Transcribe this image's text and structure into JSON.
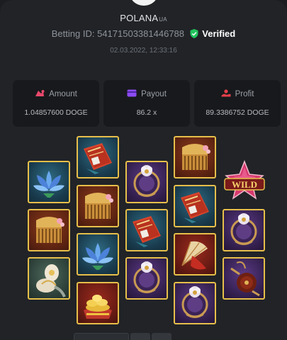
{
  "header": {
    "username": "POLANA",
    "username_suffix": "UA",
    "bet_id_label": "Betting ID:",
    "bet_id": "54171503381446788",
    "verified_label": "Verified",
    "timestamp": "02.03.2022, 12:33:16"
  },
  "stats": {
    "amount": {
      "label": "Amount",
      "value": "1.04857600 DOGE",
      "icon": "coins-icon",
      "color": "#e8486b"
    },
    "payout": {
      "label": "Payout",
      "value": "86.2 x",
      "icon": "card-icon",
      "color": "#8b4bf2"
    },
    "profit": {
      "label": "Profit",
      "value": "89.3386752 DOGE",
      "icon": "hand-coin-icon",
      "color": "#e5404a"
    }
  },
  "reels": {
    "wild_label": "WILD",
    "symbols": [
      "lotus",
      "comb",
      "book",
      "fan",
      "gold",
      "mirror",
      "purse",
      "wild"
    ]
  },
  "colors": {
    "verified": "#22c55e",
    "frame": "#e7bf4a"
  }
}
